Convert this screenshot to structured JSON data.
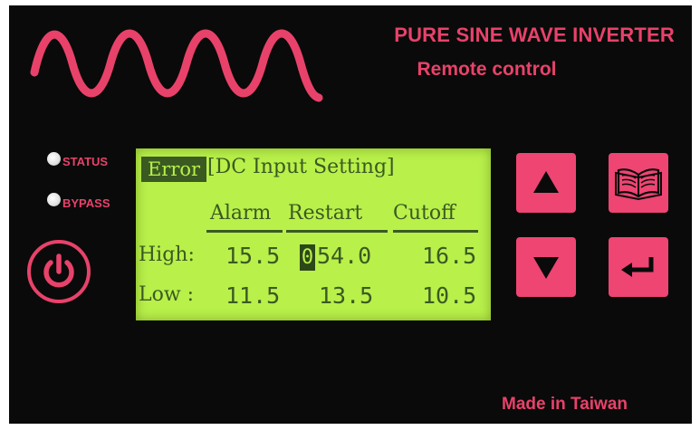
{
  "header": {
    "title": "PURE SINE WAVE INVERTER",
    "subtitle": "Remote control"
  },
  "indicators": {
    "status_label": "STATUS",
    "bypass_label": "BYPASS"
  },
  "lcd": {
    "error_tag": "Error",
    "menu_title": "[DC Input Setting]",
    "columns": [
      "Alarm",
      "Restart",
      "Cutoff"
    ],
    "rows": [
      {
        "label": "High:",
        "alarm": "15.5",
        "restart": "54.0",
        "restart_cursor": "0",
        "cutoff": "16.5"
      },
      {
        "label": "Low :",
        "alarm": "11.5",
        "restart": "13.5",
        "cutoff": "10.5"
      }
    ]
  },
  "footer": {
    "made_in": "Made in Taiwan"
  },
  "colors": {
    "panel": "#0a0a0a",
    "accent": "#e8426a",
    "lcd_bg": "#b9f04a",
    "lcd_text": "#3a5a22"
  },
  "icons": [
    "power-icon",
    "arrow-up-icon",
    "arrow-down-icon",
    "book-icon",
    "enter-icon"
  ]
}
